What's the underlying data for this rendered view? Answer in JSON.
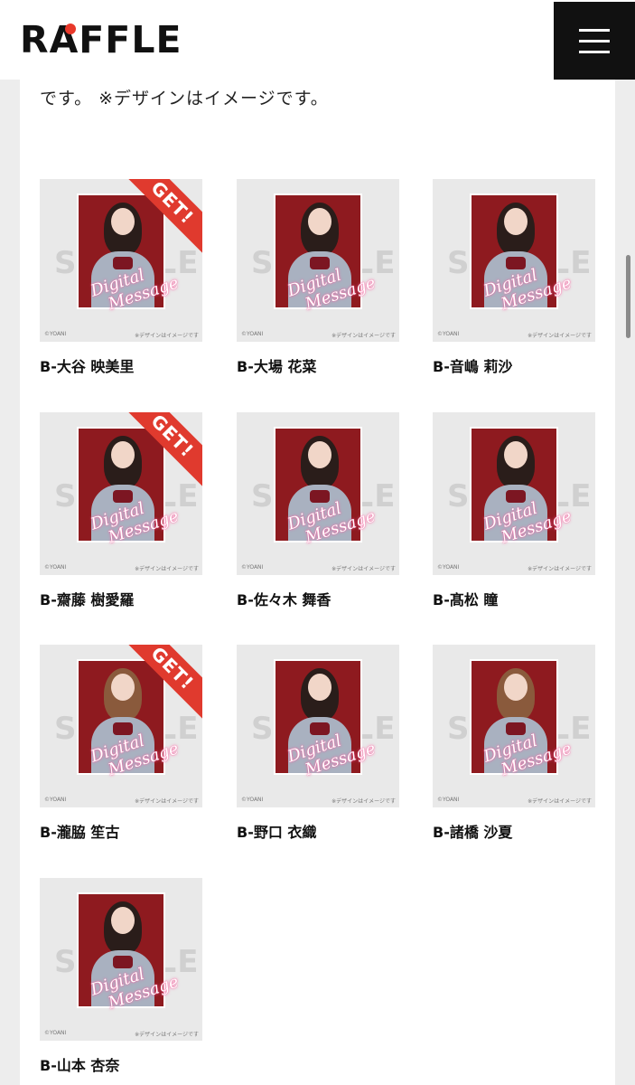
{
  "header": {
    "logo_text": "RAFFLE",
    "menu_icon": "hamburger-icon"
  },
  "intro_text": "です。 ※デザインはイメージです。",
  "cards": [
    {
      "name": "B-大谷 映美里",
      "get_label": "GET!",
      "watermark": "SAMPLE",
      "script": "Digital Message",
      "credit": "©YOANI",
      "note": "※デザインはイメージです",
      "got": true,
      "hair": "dark"
    },
    {
      "name": "B-大場 花菜",
      "get_label": "",
      "watermark": "SAMPLE",
      "script": "Digital Message",
      "credit": "©YOANI",
      "note": "※デザインはイメージです",
      "got": false,
      "hair": "dark"
    },
    {
      "name": "B-音嶋 莉沙",
      "get_label": "",
      "watermark": "SAMPLE",
      "script": "Digital Message",
      "credit": "©YOANI",
      "note": "※デザインはイメージです",
      "got": false,
      "hair": "dark"
    },
    {
      "name": "B-齋藤 樹愛羅",
      "get_label": "GET!",
      "watermark": "SAMPLE",
      "script": "Digital Message",
      "credit": "©YOANI",
      "note": "※デザインはイメージです",
      "got": true,
      "hair": "dark"
    },
    {
      "name": "B-佐々木 舞香",
      "get_label": "",
      "watermark": "SAMPLE",
      "script": "Digital Message",
      "credit": "©YOANI",
      "note": "※デザインはイメージです",
      "got": false,
      "hair": "dark"
    },
    {
      "name": "B-髙松 瞳",
      "get_label": "",
      "watermark": "SAMPLE",
      "script": "Digital Message",
      "credit": "©YOANI",
      "note": "※デザインはイメージです",
      "got": false,
      "hair": "dark"
    },
    {
      "name": "B-瀧脇 笙古",
      "get_label": "GET!",
      "watermark": "SAMPLE",
      "script": "Digital Message",
      "credit": "©YOANI",
      "note": "※デザインはイメージです",
      "got": true,
      "hair": "light"
    },
    {
      "name": "B-野口 衣織",
      "get_label": "",
      "watermark": "SAMPLE",
      "script": "Digital Message",
      "credit": "©YOANI",
      "note": "※デザインはイメージです",
      "got": false,
      "hair": "dark"
    },
    {
      "name": "B-諸橋 沙夏",
      "get_label": "",
      "watermark": "SAMPLE",
      "script": "Digital Message",
      "credit": "©YOANI",
      "note": "※デザインはイメージです",
      "got": false,
      "hair": "light"
    },
    {
      "name": "B-山本 杏奈",
      "get_label": "",
      "watermark": "SAMPLE",
      "script": "Digital Message",
      "credit": "©YOANI",
      "note": "※デザインはイメージです",
      "got": false,
      "hair": "dark"
    }
  ],
  "colors": {
    "get_badge": "#e03a2e",
    "photo_bg": "#8e1a1f",
    "logo_dot": "#e8382a"
  }
}
